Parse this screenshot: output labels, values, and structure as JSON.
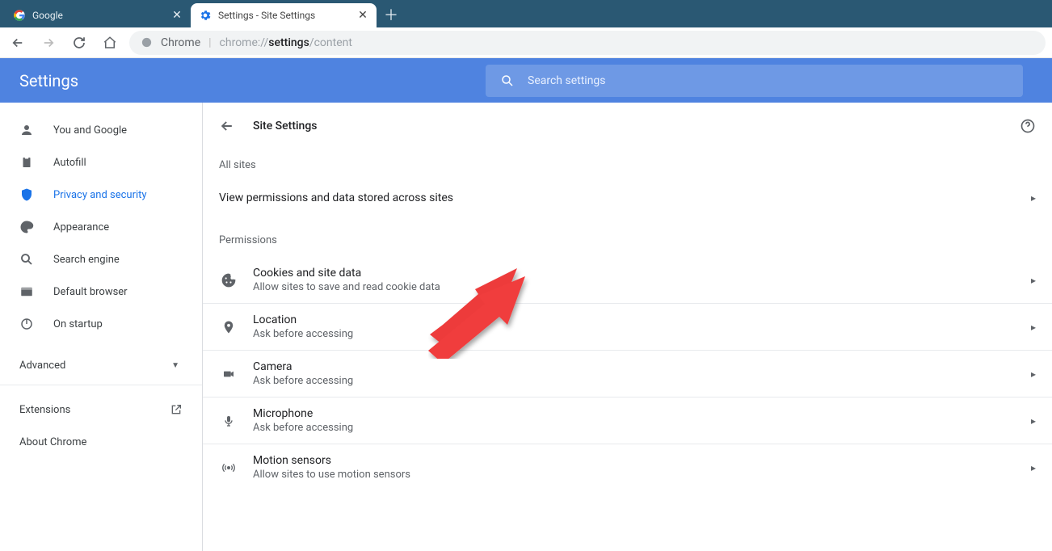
{
  "tabs": [
    {
      "title": "Google"
    },
    {
      "title": "Settings - Site Settings"
    }
  ],
  "omnibox": {
    "scheme_label": "Chrome",
    "url_prefix": "chrome://",
    "url_bold": "settings",
    "url_suffix": "/content"
  },
  "header": {
    "title": "Settings",
    "search_placeholder": "Search settings"
  },
  "sidebar": {
    "items": [
      {
        "label": "You and Google"
      },
      {
        "label": "Autofill"
      },
      {
        "label": "Privacy and security"
      },
      {
        "label": "Appearance"
      },
      {
        "label": "Search engine"
      },
      {
        "label": "Default browser"
      },
      {
        "label": "On startup"
      }
    ],
    "advanced": "Advanced",
    "extensions": "Extensions",
    "about": "About Chrome"
  },
  "content": {
    "title": "Site Settings",
    "all_sites_label": "All sites",
    "view_permissions": "View permissions and data stored across sites",
    "permissions_label": "Permissions",
    "rows": [
      {
        "title": "Cookies and site data",
        "sub": "Allow sites to save and read cookie data"
      },
      {
        "title": "Location",
        "sub": "Ask before accessing"
      },
      {
        "title": "Camera",
        "sub": "Ask before accessing"
      },
      {
        "title": "Microphone",
        "sub": "Ask before accessing"
      },
      {
        "title": "Motion sensors",
        "sub": "Allow sites to use motion sensors"
      }
    ]
  }
}
